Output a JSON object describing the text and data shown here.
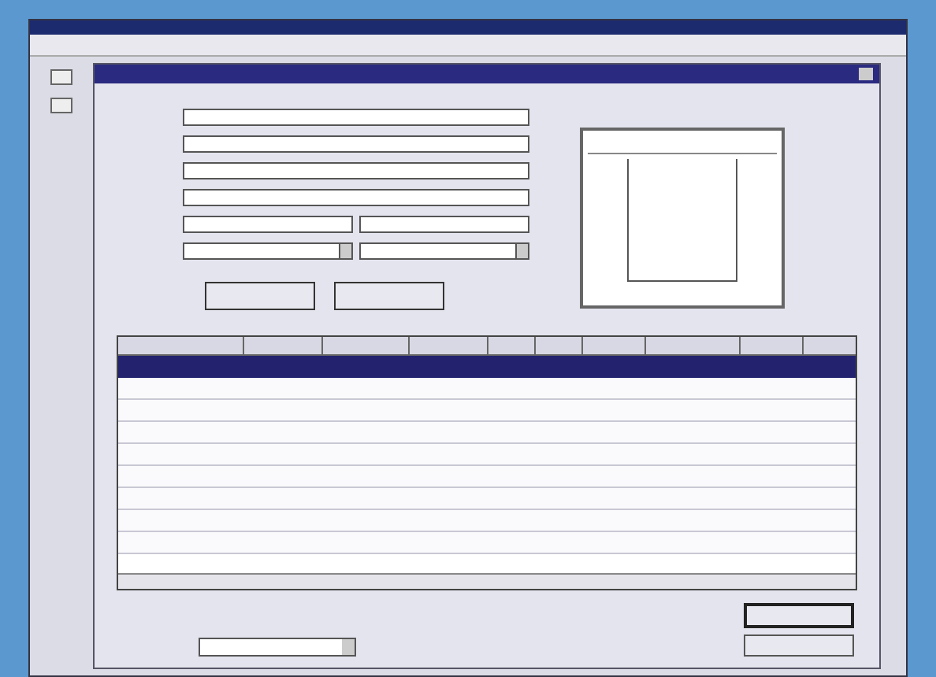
{
  "form": {
    "fields": [
      {
        "kind": "text"
      },
      {
        "kind": "text"
      },
      {
        "kind": "text"
      },
      {
        "kind": "text"
      },
      {
        "kind": "range"
      },
      {
        "kind": "date_range"
      }
    ]
  },
  "table": {
    "rows": [
      {
        "selected": true
      },
      {
        "selected": false
      },
      {
        "selected": false
      },
      {
        "selected": false
      },
      {
        "selected": false
      },
      {
        "selected": false
      },
      {
        "selected": false
      },
      {
        "selected": false
      },
      {
        "selected": false
      }
    ]
  }
}
